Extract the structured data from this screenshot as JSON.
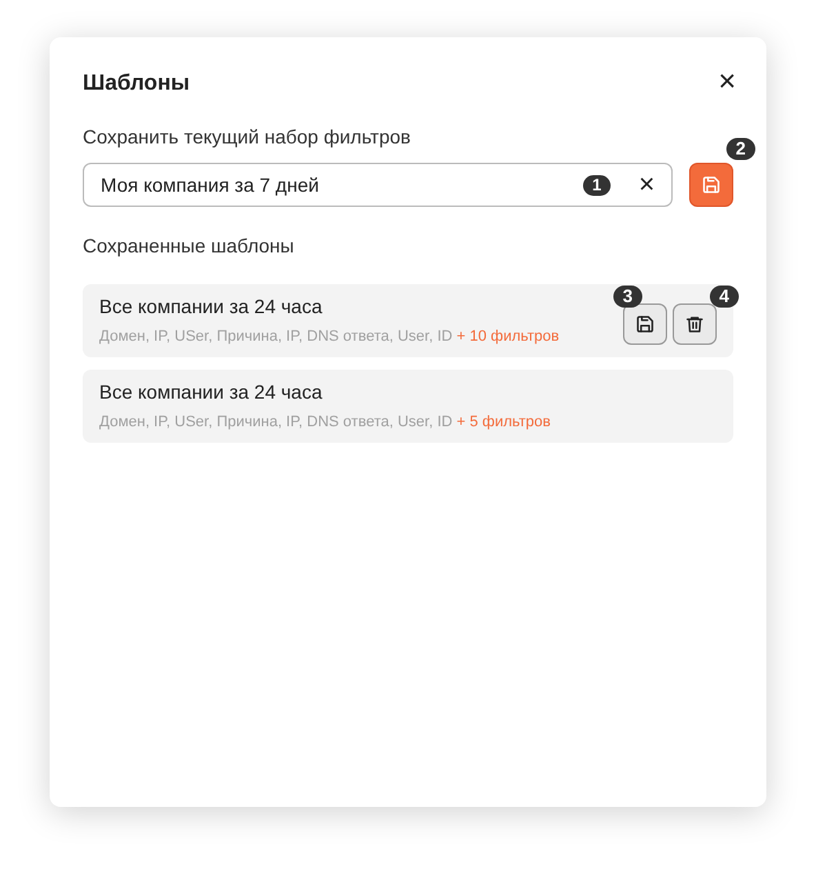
{
  "dialog": {
    "title": "Шаблоны",
    "close": "×"
  },
  "save_section": {
    "label": "Сохранить текущий набор фильтров",
    "input": {
      "value": "Моя компания за 7 дней",
      "badge": "1",
      "clear": "×"
    },
    "save_badge": "2"
  },
  "templates_section": {
    "label": "Сохраненные шаблоны",
    "templates": [
      {
        "name": "Все компании за 24 часа",
        "filters": "Домен, IP, USer, Причина, IP, DNS ответа, User, ID",
        "more": "+ 10 фильтров",
        "hovered": true,
        "save_badge": "3",
        "delete_badge": "4"
      },
      {
        "name": "Все компании за 24 часа",
        "filters": "Домен, IP, USer, Причина, IP, DNS ответа, User, ID",
        "more": "+ 5 фильтров",
        "hovered": false
      }
    ]
  }
}
